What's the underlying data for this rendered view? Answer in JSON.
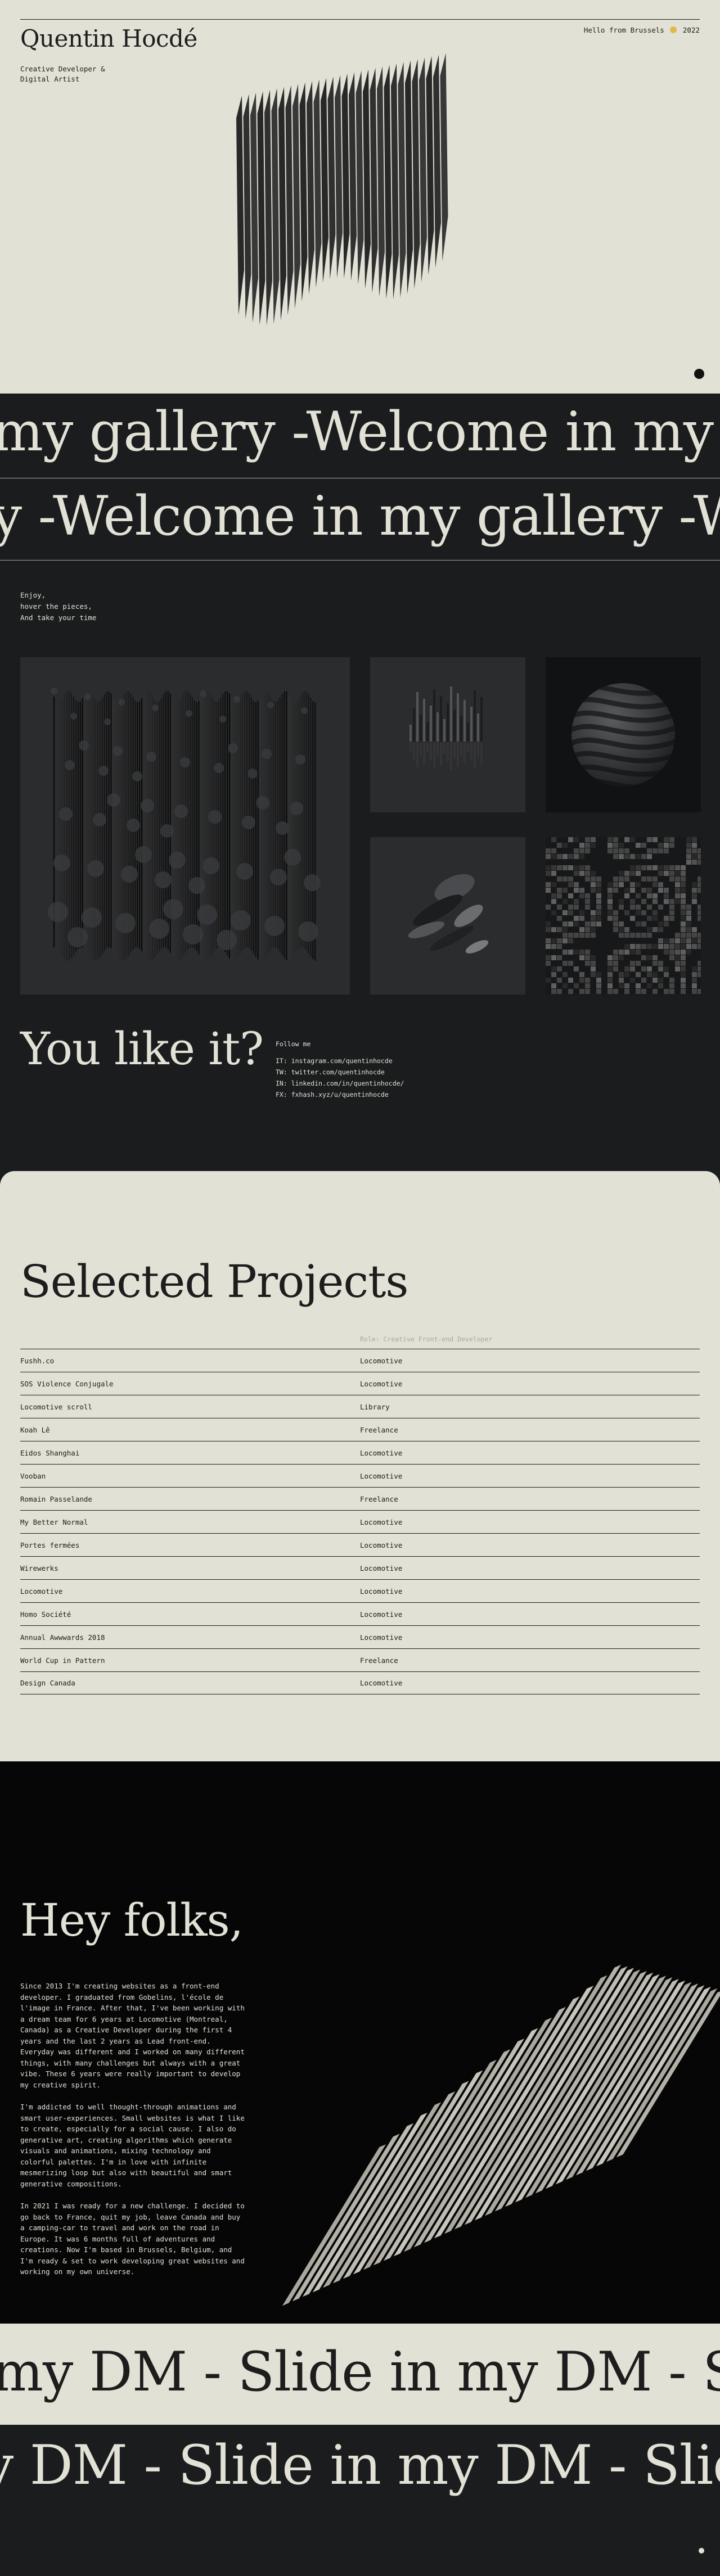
{
  "hero": {
    "site_name": "Quentin Hocdé",
    "role": "Creative Developer &\nDigital Artist",
    "hello": "Hello from Brussels",
    "flag_icon": "belgium-flag-icon",
    "year": "2022"
  },
  "marquee_gallery": {
    "row1": "my gallery -Welcome in my gallery -Welcome in my gallery -Welcome in my galler",
    "row2": "ry -Welcome in my gallery -Welcome in my gallery -Welcome in my gallery -Welc"
  },
  "gallery": {
    "intro": "Enjoy,\nhover the pieces,\nAnd take your time",
    "heading": "You like it?",
    "follow_label": "Follow me",
    "links": [
      "IT: instagram.com/quentinhocde",
      "TW: twitter.com/quentinhocde",
      "IN: linkedin.com/in/quentinhocde/",
      "FX: fxhash.xyz/u/quentinhocde"
    ]
  },
  "projects": {
    "title": "Selected Projects",
    "role_header": "Role: Creative Front-end Developer",
    "rows": [
      {
        "name": "Fushh.co",
        "role": "Locomotive"
      },
      {
        "name": "SOS Violence Conjugale",
        "role": "Locomotive"
      },
      {
        "name": "Locomotive scroll",
        "role": "Library"
      },
      {
        "name": "Koah Lê",
        "role": "Freelance"
      },
      {
        "name": "Eidos Shanghai",
        "role": "Locomotive"
      },
      {
        "name": "Vooban",
        "role": "Locomotive"
      },
      {
        "name": "Romain Passelande",
        "role": "Freelance"
      },
      {
        "name": "My Better Normal",
        "role": "Locomotive"
      },
      {
        "name": "Portes fermées",
        "role": "Locomotive"
      },
      {
        "name": "Wirewerks",
        "role": "Locomotive"
      },
      {
        "name": "Locomotive",
        "role": "Locomotive"
      },
      {
        "name": "Homo Société",
        "role": "Locomotive"
      },
      {
        "name": "Annual Awwwards 2018",
        "role": "Locomotive"
      },
      {
        "name": "World Cup in Pattern",
        "role": "Freelance"
      },
      {
        "name": "Design Canada",
        "role": "Locomotive"
      }
    ]
  },
  "about": {
    "heading": "Hey folks,",
    "paragraphs": [
      "Since 2013 I'm creating websites as a front-end developer. I graduated from Gobelins, l'école de l'image in France. After that, I've been working with a dream team for 6 years at Locomotive (Montreal, Canada) as a Creative Developer during the first 4 years and the last 2 years as Lead front-end. Everyday was different and I worked on many different things, with many challenges but always with a great vibe. These 6 years were really important to develop my creative spirit.",
      "I'm addicted to well thought-through animations and smart user-experiences. Small websites is what I like to create, especially for a social cause. I also do generative art, creating algorithms which generate visuals and animations, mixing technology and colorful palettes. I'm in love with infinite mesmerizing loop but also with beautiful and smart generative compositions.",
      "In 2021 I was ready for a new challenge. I decided to go back to France, quit my job, leave Canada and buy a camping-car to travel and work on the road in Europe. It was 6 months full of adventures and creations. Now I'm based in Brussels, Belgium, and I'm ready & set to work developing great websites and working on my own universe."
    ]
  },
  "marquee_dm": {
    "row1": "my DM - Slide in my DM - Slide in my DM - Slide in",
    "row2": "y DM - Slide in my DM - Slide in my DM - Slide in n"
  },
  "colors": {
    "paper": "#e2e1d6",
    "ink": "#1d1d1d",
    "dark": "#1b1c1e",
    "black": "#060606",
    "flag": "#e0b94a"
  }
}
